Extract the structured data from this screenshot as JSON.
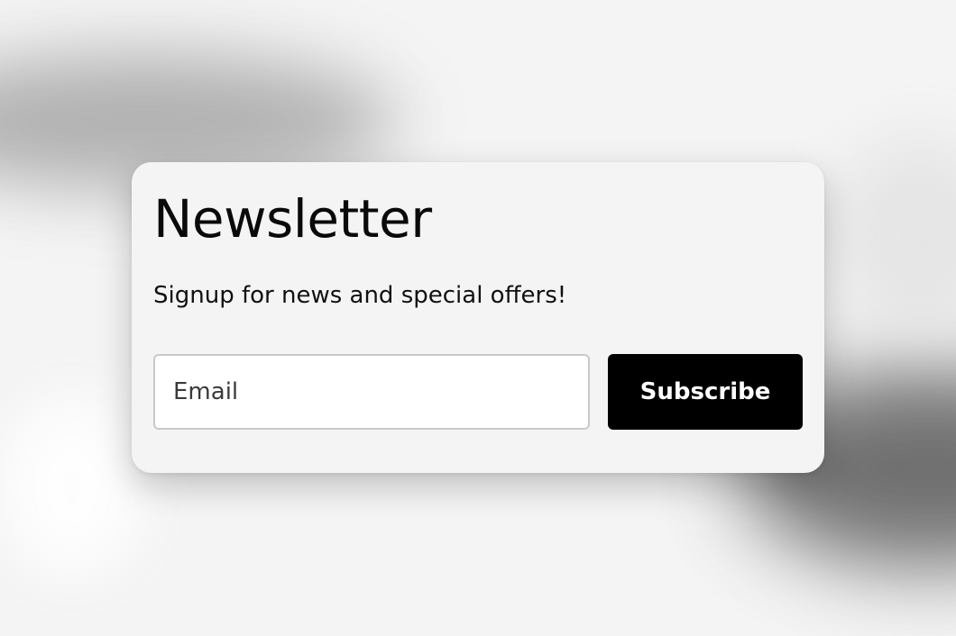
{
  "newsletter": {
    "title": "Newsletter",
    "subtitle": "Signup for news and special offers!",
    "email_placeholder": "Email",
    "subscribe_label": "Subscribe"
  },
  "colors": {
    "button_background": "#000000",
    "button_text": "#ffffff",
    "card_background": "#f4f4f4",
    "input_border": "#c9c9c9"
  }
}
